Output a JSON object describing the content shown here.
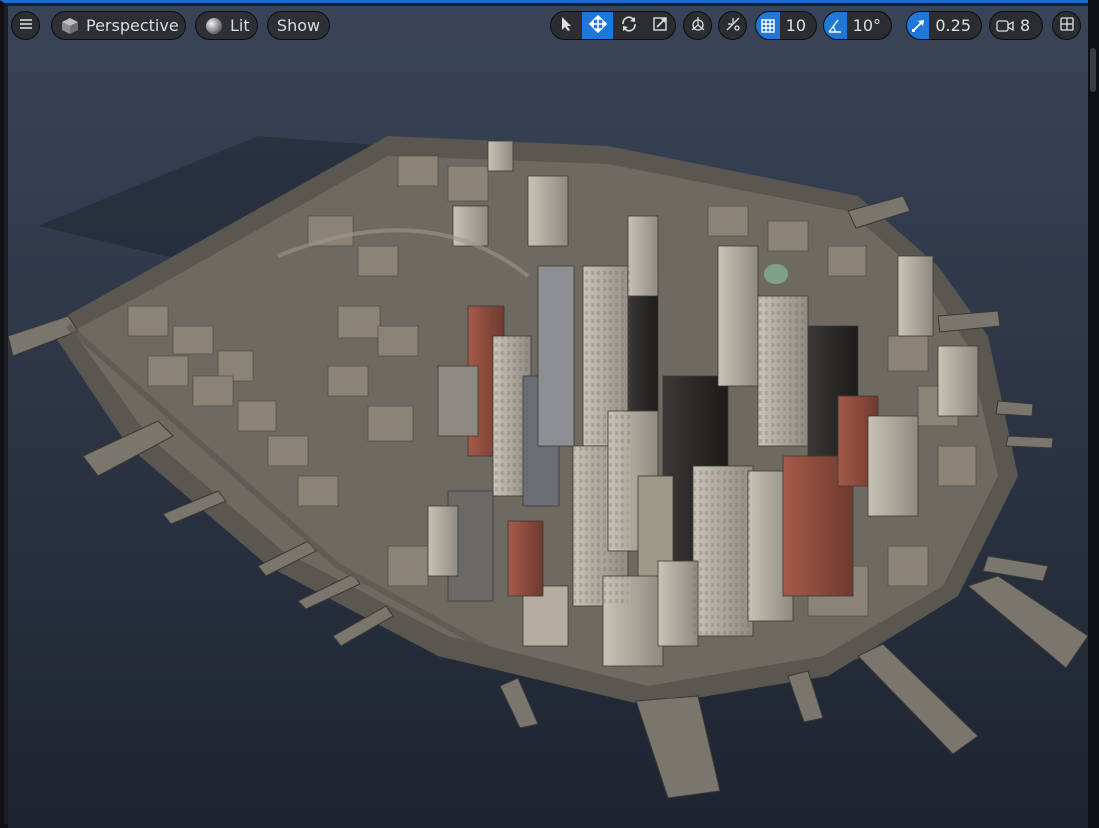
{
  "toolbar": {
    "perspective_label": "Perspective",
    "lit_label": "Lit",
    "show_label": "Show",
    "grid_snap_value": "10",
    "rotation_snap_value": "10°",
    "scale_snap_value": "0.25",
    "camera_speed_value": "8"
  },
  "colors": {
    "accent": "#1f78d9",
    "viewport_bg": "#2c3444",
    "toolbar_button": "#2b2d31"
  },
  "icons": {
    "menu": "hamburger-icon",
    "perspective": "cube-icon",
    "lit": "sphere-icon",
    "select": "cursor-icon",
    "translate": "move-arrows-icon",
    "rotate": "rotate-icon",
    "scale": "scale-icon",
    "world_local": "world-axes-icon",
    "surface_snap": "surface-snap-icon",
    "grid": "grid-icon",
    "angle": "angle-icon",
    "scale_snap": "scale-arrow-icon",
    "camera": "camera-icon",
    "layout": "layout-icon"
  }
}
